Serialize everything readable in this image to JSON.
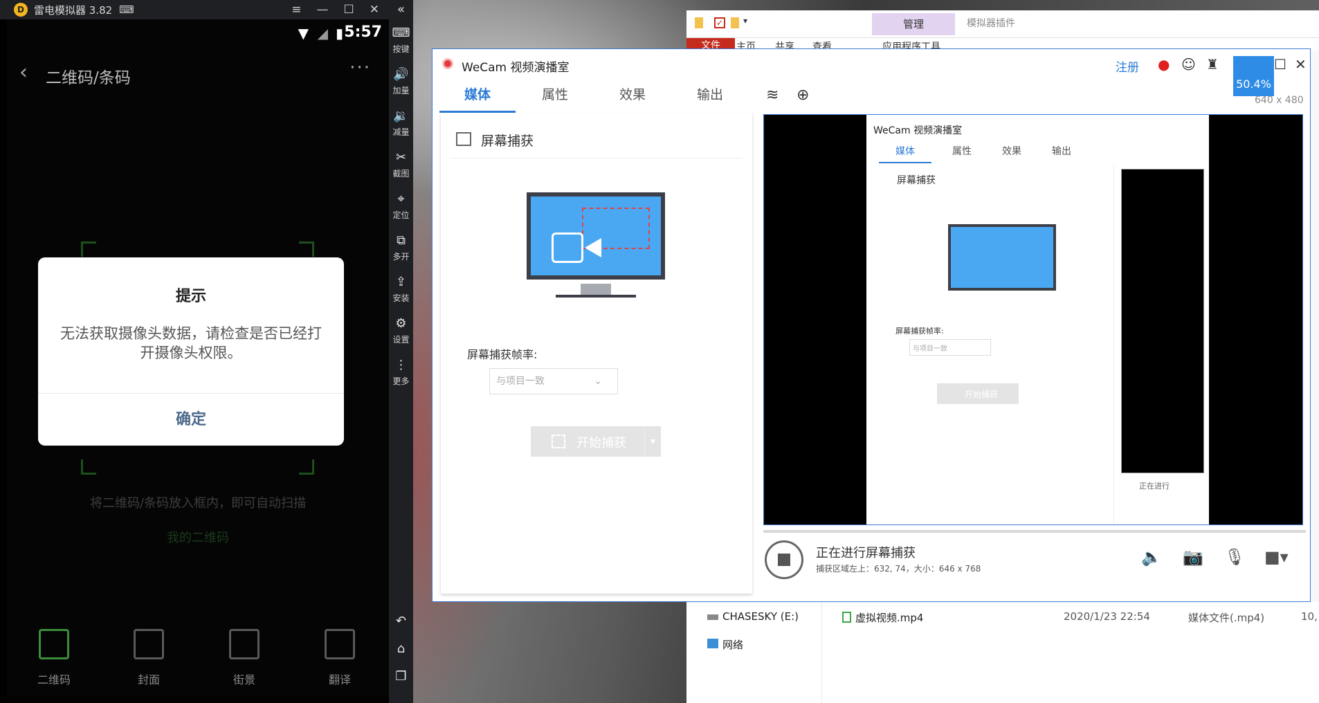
{
  "emulator": {
    "title": "雷电模拟器 3.82",
    "status_time": "5:57",
    "app_title": "二维码/条码",
    "more": "···",
    "scan_hint": "将二维码/条码放入框内，即可自动扫描",
    "my_qr": "我的二维码",
    "dialog": {
      "title": "提示",
      "message": "无法获取摄像头数据，请检查是否已经打开摄像头权限。",
      "ok": "确定"
    },
    "bottom_nav": [
      "二维码",
      "封面",
      "街景",
      "翻译"
    ],
    "toolbar": [
      "按键",
      "加量",
      "减量",
      "截图",
      "定位",
      "多开",
      "安装",
      "设置",
      "更多"
    ]
  },
  "explorer": {
    "manage": "管理",
    "app_tools": "应用程序工具",
    "plugins": "模拟器插件",
    "tabs": [
      "文件",
      "主页",
      "共享",
      "查看"
    ],
    "drive": "CHASESKY (E:)",
    "network": "网络",
    "file": {
      "name": "虚拟视频.mp4",
      "date": "2020/1/23 22:54",
      "type": "媒体文件(.mp4)",
      "size": "10,"
    }
  },
  "wecam": {
    "title": "WeCam 视频演播室",
    "register": "注册",
    "zoom": "50.4%",
    "resolution": "640 x 480",
    "tabs": [
      "媒体",
      "属性",
      "效果",
      "输出"
    ],
    "panel_title": "屏幕捕获",
    "frame_rate_label": "屏幕捕获帧率:",
    "frame_rate_value": "与项目一致",
    "start_label": "开始捕获",
    "status": "正在进行屏幕捕获",
    "status_detail": "捕获区域左上：632, 74，大小：646 x 768",
    "mini_stop_status": "正在进行",
    "colors": {
      "accent": "#2b7bd6",
      "monitor": "#4aa8f3",
      "emulator_bg": "#1f2023"
    }
  }
}
